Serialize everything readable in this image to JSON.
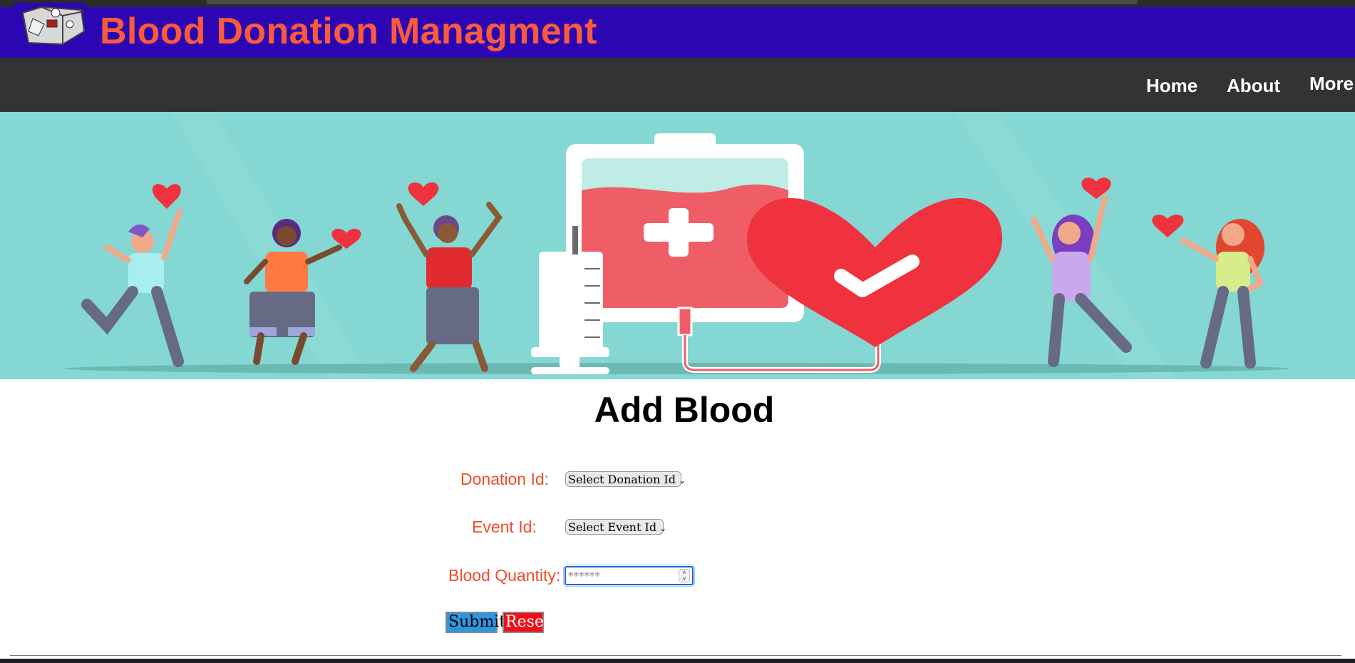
{
  "header": {
    "title": "Blood Donation Managment",
    "logo_icon": "blood-donation-logo-icon",
    "bg_color": "#2b06b2",
    "title_color": "#fa5a3c"
  },
  "nav": {
    "items": [
      {
        "label": "Home"
      },
      {
        "label": "About"
      },
      {
        "label": "More"
      }
    ]
  },
  "hero": {
    "image": "blood-donation-banner-illustration",
    "bg_color": "#84d7d2"
  },
  "form": {
    "title": "Add Blood",
    "donation_id": {
      "label": "Donation Id:",
      "selected": "Select Donation Id"
    },
    "event_id": {
      "label": "Event Id:",
      "selected": "Select Event Id"
    },
    "blood_quantity": {
      "label": "Blood Quantity:",
      "value": "",
      "placeholder": "******"
    },
    "submit_label": "Submit",
    "reset_label": "Reset"
  }
}
